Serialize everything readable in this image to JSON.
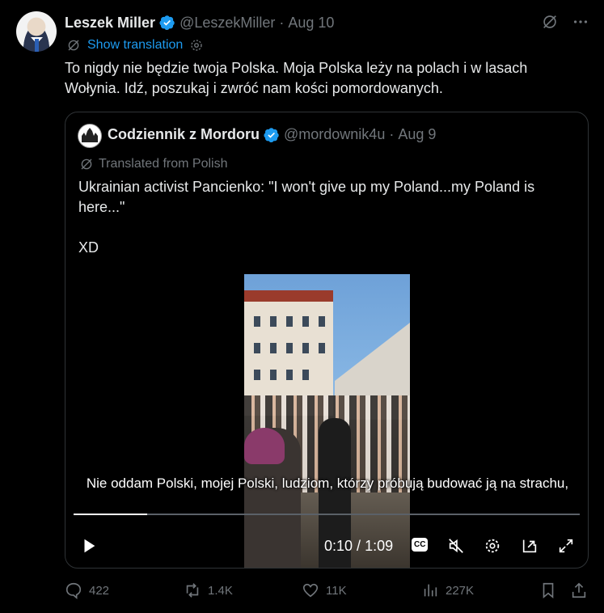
{
  "post": {
    "author_name": "Leszek Miller",
    "author_handle": "@LeszekMiller",
    "separator": "·",
    "date": "Aug 10",
    "show_translation": "Show translation",
    "text": "To nigdy nie będzie twoja Polska. Moja Polska leży na polach i w lasach Wołynia. Idź, poszukaj i zwróć nam kości pomordowanych."
  },
  "quote": {
    "author_name": "Codziennik z Mordoru",
    "author_handle": "@mordownik4u",
    "separator": "·",
    "date": "Aug 9",
    "translated_label": "Translated from Polish",
    "text": "Ukrainian activist Pancienko: \"I won't give up my Poland...my Poland is here...\"\n\nXD"
  },
  "video": {
    "subtitle": "Nie oddam Polski, mojej Polski, ludziom, którzy próbują budować ją na strachu,",
    "current_time": "0:10",
    "time_separator": " / ",
    "duration": "1:09",
    "progress": 0.145,
    "cc_label": "CC"
  },
  "actions": {
    "replies": "422",
    "reposts": "1.4K",
    "likes": "11K",
    "views": "227K"
  },
  "colors": {
    "accent": "#1d9bf0",
    "muted": "#71767b",
    "text": "#e7e9ea",
    "border": "#2f3336"
  },
  "icons": [
    "grok-icon",
    "more-icon",
    "translate-icon",
    "settings-icon",
    "verified-icon",
    "play-icon",
    "cc-icon",
    "mute-icon",
    "gear-icon",
    "pip-icon",
    "fullscreen-icon",
    "reply-icon",
    "repost-icon",
    "like-icon",
    "views-icon",
    "bookmark-icon",
    "share-icon"
  ]
}
